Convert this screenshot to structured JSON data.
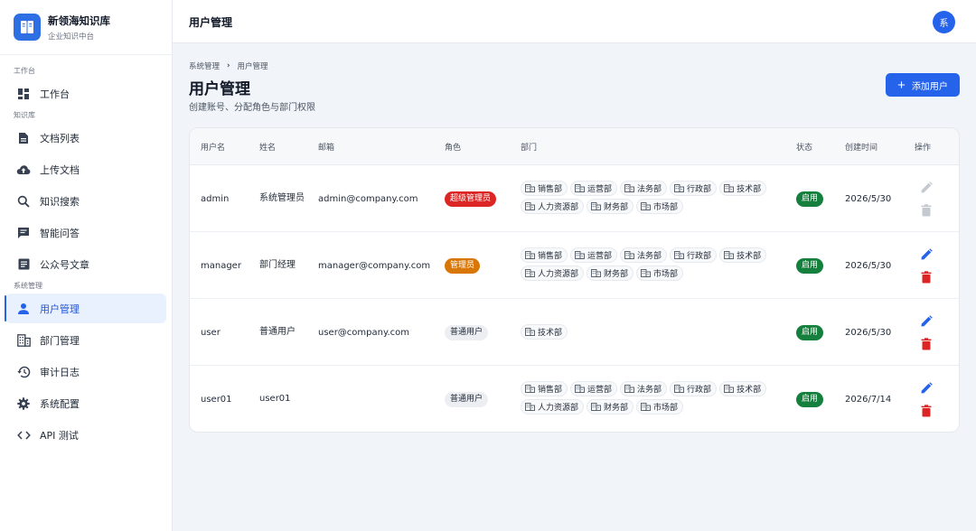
{
  "brand": {
    "title": "新领海知识库",
    "subtitle": "企业知识中台"
  },
  "sidebar": {
    "sections": [
      {
        "label": "工作台",
        "items": [
          {
            "label": "工作台",
            "icon": "dashboard-icon"
          }
        ]
      },
      {
        "label": "知识库",
        "items": [
          {
            "label": "文档列表",
            "icon": "document-icon"
          },
          {
            "label": "上传文档",
            "icon": "cloud-upload-icon"
          },
          {
            "label": "知识搜索",
            "icon": "search-icon"
          },
          {
            "label": "智能问答",
            "icon": "chat-icon"
          },
          {
            "label": "公众号文章",
            "icon": "article-icon"
          }
        ]
      },
      {
        "label": "系统管理",
        "items": [
          {
            "label": "用户管理",
            "icon": "user-icon",
            "active": true
          },
          {
            "label": "部门管理",
            "icon": "building-icon"
          },
          {
            "label": "审计日志",
            "icon": "history-icon"
          },
          {
            "label": "系统配置",
            "icon": "gear-icon"
          },
          {
            "label": "API 测试",
            "icon": "code-icon"
          }
        ]
      }
    ]
  },
  "topbar": {
    "title": "用户管理",
    "avatar": "系"
  },
  "breadcrumb": {
    "parent": "系统管理",
    "current": "用户管理"
  },
  "page": {
    "title": "用户管理",
    "subtitle": "创建账号、分配角色与部门权限",
    "add_button": "添加用户"
  },
  "table": {
    "headers": [
      "用户名",
      "姓名",
      "邮箱",
      "角色",
      "部门",
      "状态",
      "创建时间",
      "操作"
    ],
    "rows": [
      {
        "username": "admin",
        "name": "系统管理员",
        "email": "admin@company.com",
        "role": "超级管理员",
        "role_type": "super",
        "depts": [
          "销售部",
          "运营部",
          "法务部",
          "行政部",
          "技术部",
          "人力资源部",
          "财务部",
          "市场部"
        ],
        "status": "启用",
        "created": "2026/5/30",
        "editable": false
      },
      {
        "username": "manager",
        "name": "部门经理",
        "email": "manager@company.com",
        "role": "管理员",
        "role_type": "admin",
        "depts": [
          "销售部",
          "运营部",
          "法务部",
          "行政部",
          "技术部",
          "人力资源部",
          "财务部",
          "市场部"
        ],
        "status": "启用",
        "created": "2026/5/30",
        "editable": true
      },
      {
        "username": "user",
        "name": "普通用户",
        "email": "user@company.com",
        "role": "普通用户",
        "role_type": "user",
        "depts": [
          "技术部"
        ],
        "status": "启用",
        "created": "2026/5/30",
        "editable": true
      },
      {
        "username": "user01",
        "name": "user01",
        "email": "",
        "role": "普通用户",
        "role_type": "user",
        "depts": [
          "销售部",
          "运营部",
          "法务部",
          "行政部",
          "技术部",
          "人力资源部",
          "财务部",
          "市场部"
        ],
        "status": "启用",
        "created": "2026/7/14",
        "editable": true
      }
    ]
  },
  "colors": {
    "primary": "#2563eb",
    "super_admin": "#dc2626",
    "admin": "#d97706",
    "enabled": "#15803d",
    "delete": "#dc2626",
    "disabled_action": "#c4c8cf"
  }
}
